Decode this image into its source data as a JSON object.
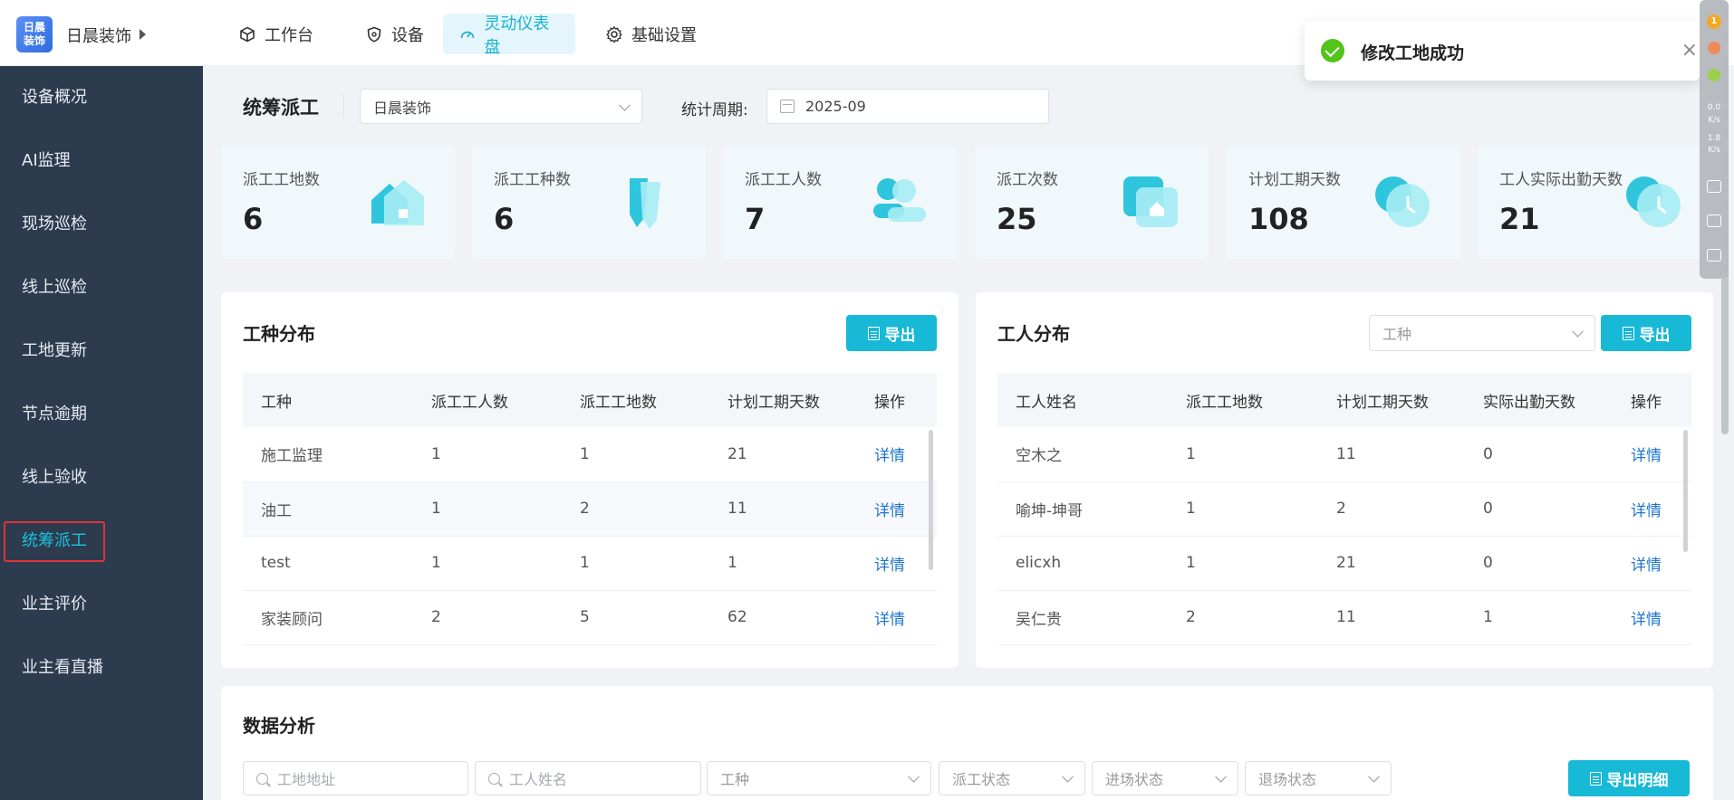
{
  "header": {
    "logo_text": "日晨\n装饰",
    "company": "日晨装饰",
    "nav": [
      {
        "label": "工作台",
        "icon": "cube-icon"
      },
      {
        "label": "设备",
        "icon": "shield-icon"
      },
      {
        "label": "灵动仪表盘",
        "icon": "dashboard-icon"
      },
      {
        "label": "基础设置",
        "icon": "gear-icon"
      }
    ],
    "active_nav": "灵动仪表盘"
  },
  "sidebar": {
    "items": [
      {
        "label": "设备概况"
      },
      {
        "label": "AI监理"
      },
      {
        "label": "现场巡检"
      },
      {
        "label": "线上巡检"
      },
      {
        "label": "工地更新"
      },
      {
        "label": "节点逾期"
      },
      {
        "label": "线上验收"
      },
      {
        "label": "统筹派工"
      },
      {
        "label": "业主评价"
      },
      {
        "label": "业主看直播"
      }
    ],
    "active": "统筹派工"
  },
  "page": {
    "title": "统筹派工",
    "company_select": "日晨装饰",
    "period_label": "统计周期:",
    "period_value": "2025-09"
  },
  "stats": [
    {
      "label": "派工工地数",
      "value": "6"
    },
    {
      "label": "派工工种数",
      "value": "6"
    },
    {
      "label": "派工工人数",
      "value": "7"
    },
    {
      "label": "派工次数",
      "value": "25"
    },
    {
      "label": "计划工期天数",
      "value": "108"
    },
    {
      "label": "工人实际出勤天数",
      "value": "21"
    }
  ],
  "trade_panel": {
    "title": "工种分布",
    "export": "导出",
    "columns": [
      "工种",
      "派工工人数",
      "派工工地数",
      "计划工期天数",
      "操作"
    ],
    "rows": [
      [
        "施工监理",
        "1",
        "1",
        "21",
        "详情"
      ],
      [
        "油工",
        "1",
        "2",
        "11",
        "详情"
      ],
      [
        "test",
        "1",
        "1",
        "1",
        "详情"
      ],
      [
        "家装顾问",
        "2",
        "5",
        "62",
        "详情"
      ]
    ]
  },
  "worker_panel": {
    "title": "工人分布",
    "filter_placeholder": "工种",
    "export": "导出",
    "columns": [
      "工人姓名",
      "派工工地数",
      "计划工期天数",
      "实际出勤天数",
      "操作"
    ],
    "rows": [
      [
        "空木之",
        "1",
        "11",
        "0",
        "详情"
      ],
      [
        "喻坤-坤哥",
        "1",
        "2",
        "0",
        "详情"
      ],
      [
        "elicxh",
        "1",
        "21",
        "0",
        "详情"
      ],
      [
        "吴仁贵",
        "2",
        "11",
        "1",
        "详情"
      ]
    ]
  },
  "analysis": {
    "title": "数据分析",
    "site_address_placeholder": "工地地址",
    "worker_name_placeholder": "工人姓名",
    "trade_placeholder": "工种",
    "dispatch_status_placeholder": "派工状态",
    "entry_status_placeholder": "进场状态",
    "exit_status_placeholder": "退场状态",
    "export_detail": "导出明细"
  },
  "toast": {
    "message": "修改工地成功",
    "close": "×"
  },
  "tool_strip": {
    "badge": "1",
    "up": "0.0",
    "up_unit": "K/s",
    "down": "1.8",
    "down_unit": "K/s"
  },
  "colors": {
    "accent": "#18b9d6",
    "sidebar_bg": "#2d3b4e",
    "link": "#1e76d0",
    "success": "#52c41a",
    "highlight_border": "#e0323a"
  }
}
